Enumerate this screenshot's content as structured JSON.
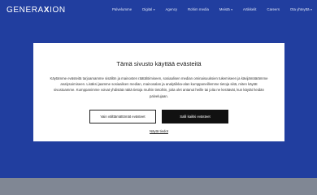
{
  "header": {
    "logo_text": "GENERA",
    "logo_x": "X",
    "logo_suffix": "ION",
    "nav": [
      {
        "label": "Palvelumme",
        "has_dropdown": false
      },
      {
        "label": "Digital",
        "has_dropdown": true
      },
      {
        "label": "Agency",
        "has_dropdown": false
      },
      {
        "label": "Rohim media",
        "has_dropdown": false
      },
      {
        "label": "Meistä",
        "has_dropdown": true
      },
      {
        "label": "Artikkelit",
        "has_dropdown": false
      },
      {
        "label": "Careers",
        "has_dropdown": false
      },
      {
        "label": "Ota yhteyttä",
        "has_dropdown": true
      }
    ]
  },
  "cookie_modal": {
    "title": "Tämä sivusto käyttää evästeitä",
    "body": "Käytämme evästeitä tarjoamamme sisällön ja mainosten räätälöimiseen, sosiaalisen median ominaisuuksien tukemiseen ja kävijämäärämme analysoimiseen. Lisäksi jaamme sosiaalisen median, mainosalan ja analytiikka-alan kumppaneillemme tietoja siitä, miten käytät sivustoamme. Kumppanimme voivat yhdistää näitä tietoja muihin tietoihin, joita olet antanut heille tai joita ne keräävät, kun käytät heidän palvelujaan.",
    "necessary_button": "Vain välttämättömät evästeet",
    "accept_button": "Salli kaikki evästeet",
    "details_link": "Näytä tiedot"
  },
  "colors": {
    "hero": "#2647b5",
    "accept_button_bg": "#111111",
    "modal_bg": "#ffffff"
  }
}
